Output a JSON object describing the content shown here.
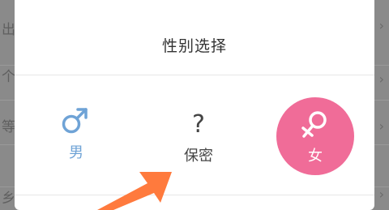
{
  "background": {
    "row_chars": [
      "出",
      "个",
      "等",
      "乡"
    ]
  },
  "dialog": {
    "title": "性别选择",
    "options": [
      {
        "label": "男",
        "icon": "male-symbol-icon",
        "color": "#6fa3d6"
      },
      {
        "label": "保密",
        "icon": "question-mark-icon",
        "glyph": "?"
      },
      {
        "label": "女",
        "icon": "female-symbol-icon",
        "color": "#f06c98",
        "selected": true
      }
    ]
  },
  "annotation": {
    "icon": "orange-pointer-arrow-icon",
    "color": "#ff7a3d"
  }
}
